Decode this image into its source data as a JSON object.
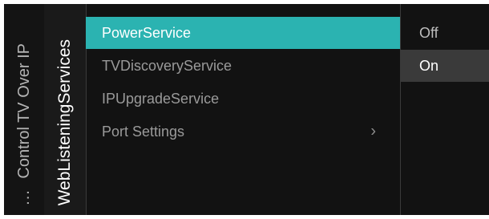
{
  "breadcrumb": {
    "ellipsis": "...",
    "parent_label": "Control TV Over IP",
    "current_label": "WebListeningServices"
  },
  "menu": {
    "items": [
      {
        "label": "PowerService",
        "selected": true
      },
      {
        "label": "TVDiscoveryService",
        "selected": false
      },
      {
        "label": "IPUpgradeService",
        "selected": false
      },
      {
        "label": "Port Settings",
        "selected": false,
        "chevron": "›"
      }
    ]
  },
  "options": {
    "items": [
      {
        "label": "Off",
        "active": false
      },
      {
        "label": "On",
        "active": true
      }
    ]
  },
  "colors": {
    "accent": "#2bb3b1",
    "background": "#121212",
    "option_highlight": "#3a3a3a"
  },
  "icons": {
    "submenu": "chevron-right-icon"
  }
}
